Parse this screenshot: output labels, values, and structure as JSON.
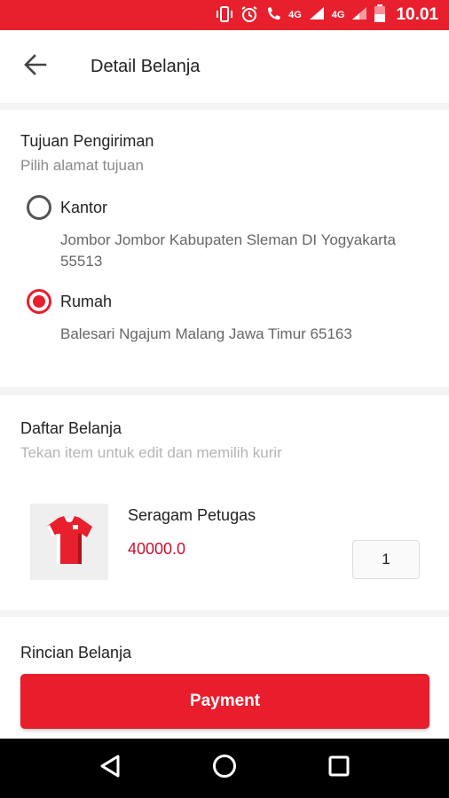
{
  "status_bar": {
    "network_label_1": "4G",
    "network_label_2": "4G",
    "time": "10.01",
    "icons": [
      "vibrate-icon",
      "alarm-icon",
      "wifi-call-icon",
      "signal-icon",
      "signal-icon",
      "battery-icon"
    ]
  },
  "app_bar": {
    "title": "Detail Belanja",
    "back_icon": "arrow-left-icon"
  },
  "shipping": {
    "title": "Tujuan Pengiriman",
    "subtitle": "Pilih alamat tujuan",
    "options": [
      {
        "label": "Kantor",
        "address": "Jombor Jombor Kabupaten Sleman DI Yogyakarta 55513",
        "selected": false
      },
      {
        "label": "Rumah",
        "address": "Balesari Ngajum Malang Jawa Timur 65163",
        "selected": true
      }
    ]
  },
  "cart": {
    "title": "Daftar Belanja",
    "subtitle": "Tekan item untuk edit dan memilih kurir",
    "items": [
      {
        "name": "Seragam Petugas",
        "price": "40000.0",
        "quantity": "1",
        "thumbnail_icon": "shirt-icon"
      }
    ]
  },
  "summary": {
    "title": "Rincian Belanja"
  },
  "payment_button": {
    "label": "Payment"
  },
  "colors": {
    "accent": "#e8202e",
    "price": "#c8102e",
    "status_bar": "#e8202e",
    "nav_bar": "#000000"
  },
  "nav": {
    "icons": [
      "back-triangle-icon",
      "home-circle-icon",
      "recents-square-icon"
    ]
  }
}
